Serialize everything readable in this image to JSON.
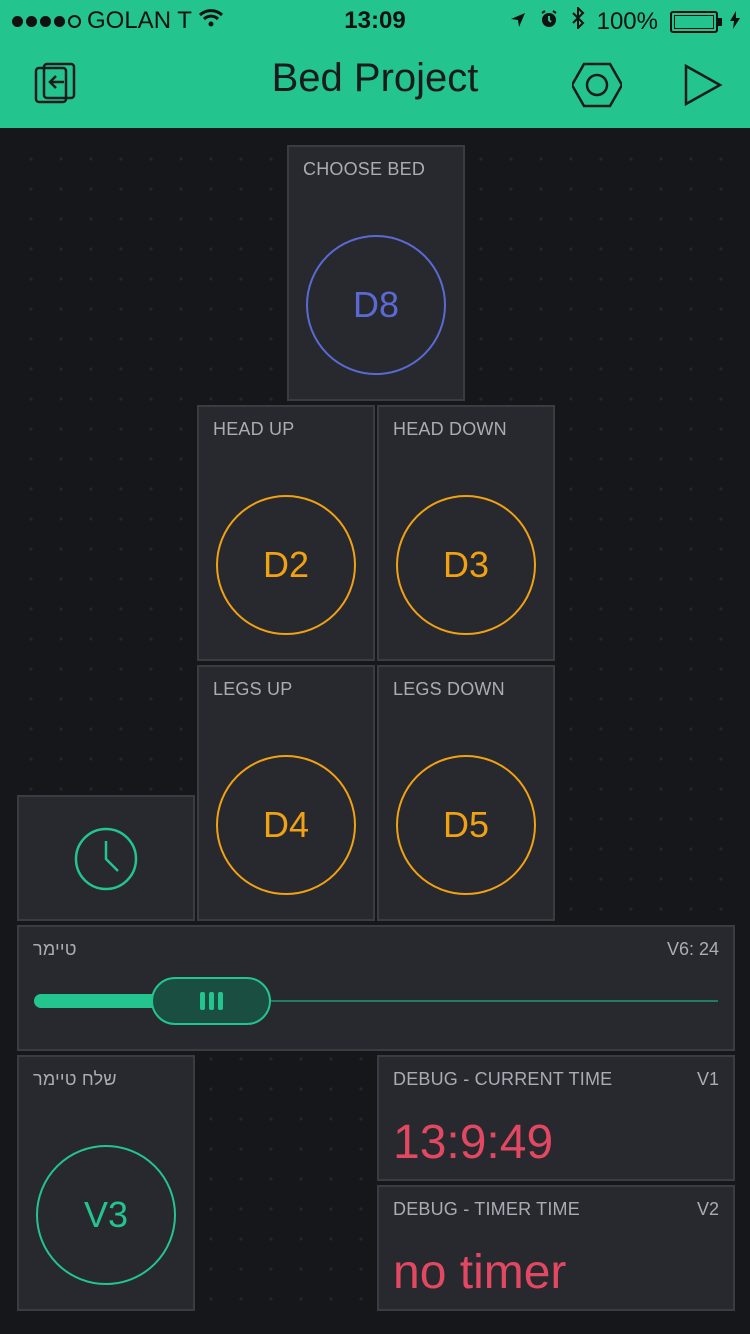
{
  "status_bar": {
    "carrier": "GOLAN T",
    "time": "13:09",
    "battery": "100%"
  },
  "header": {
    "title": "Bed Project"
  },
  "widgets": {
    "choose_bed": {
      "label": "CHOOSE BED",
      "pin": "D8"
    },
    "head_up": {
      "label": "HEAD UP",
      "pin": "D2"
    },
    "head_down": {
      "label": "HEAD DOWN",
      "pin": "D3"
    },
    "legs_up": {
      "label": "LEGS UP",
      "pin": "D4"
    },
    "legs_down": {
      "label": "LEGS DOWN",
      "pin": "D5"
    },
    "timer_slider": {
      "label": "טיימר",
      "readout": "V6: 24",
      "value": 24
    },
    "send_timer": {
      "label": "שלח טיימר",
      "pin": "V3"
    },
    "debug_current": {
      "label": "DEBUG - CURRENT TIME",
      "pin": "V1",
      "value": "13:9:49"
    },
    "debug_timer": {
      "label": "DEBUG - TIMER TIME",
      "pin": "V2",
      "value": "no timer"
    }
  },
  "colors": {
    "accent": "#23c48e",
    "blue": "#5b6ad3",
    "orange": "#f0a114",
    "red": "#e24862",
    "background": "#16171b",
    "tile": "#27292e"
  },
  "icons": {
    "back": "exit-icon",
    "settings": "hexagon-nut-icon",
    "play": "play-icon",
    "timer": "clock-icon",
    "wifi": "wifi-icon",
    "location": "location-arrow-icon",
    "alarm": "alarm-icon",
    "bluetooth": "bluetooth-icon",
    "charging": "bolt-icon"
  }
}
